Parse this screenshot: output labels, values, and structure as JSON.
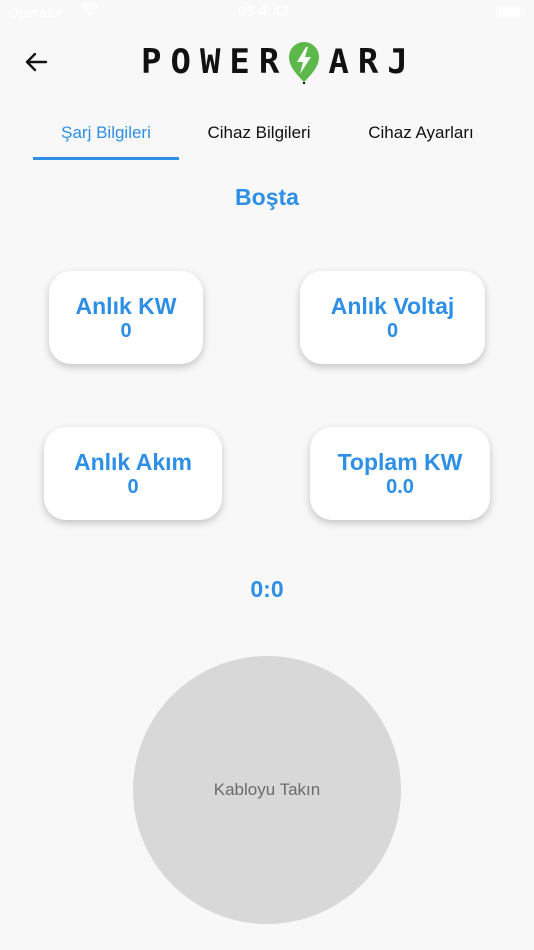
{
  "status_bar": {
    "carrier": "Operatör",
    "time": "05 4:43"
  },
  "header": {
    "logo_left": "POWER",
    "logo_right": "ARJ",
    "back_icon": "arrow-left-icon",
    "logo_icon": "plug-leaf-icon"
  },
  "tabs": [
    {
      "label": "Şarj Bilgileri",
      "active": true
    },
    {
      "label": "Cihaz Bilgileri",
      "active": false
    },
    {
      "label": "Cihaz Ayarları",
      "active": false
    }
  ],
  "main": {
    "status": "Boşta",
    "cards": [
      {
        "title": "Anlık KW",
        "value": "0"
      },
      {
        "title": "Anlık Voltaj",
        "value": "0"
      },
      {
        "title": "Anlık Akım",
        "value": "0"
      },
      {
        "title": "Toplam KW",
        "value": "0.0"
      }
    ],
    "timer": "0:0",
    "plug_button": "Kabloyu Takın"
  },
  "colors": {
    "accent": "#2e8fe6",
    "logo_green": "#5cb84a",
    "background": "#f8f8f8",
    "circle": "#d8d8d8"
  }
}
